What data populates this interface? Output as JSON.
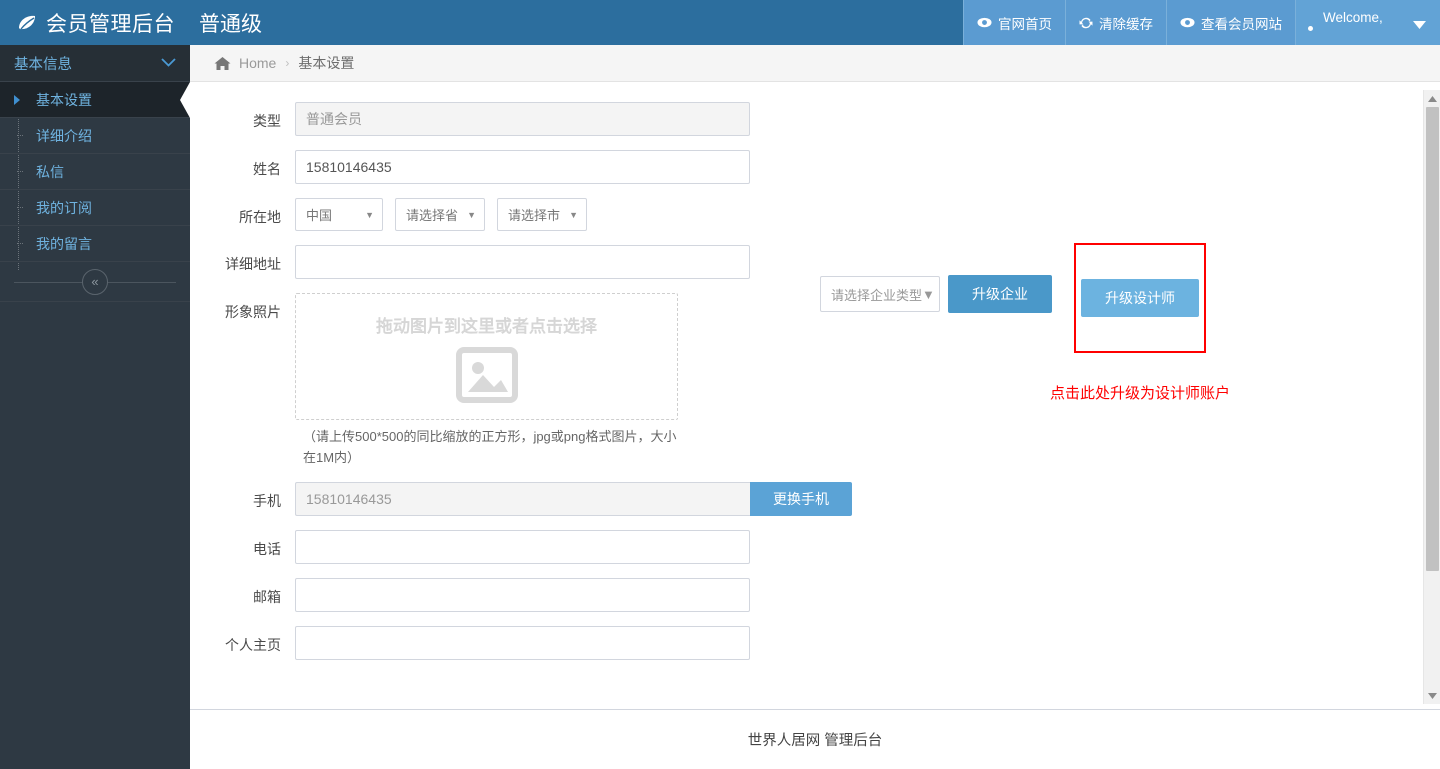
{
  "navbar": {
    "brand_title": "会员管理后台",
    "brand_level": "普通级",
    "logo_icon": "leaf-icon",
    "items": [
      {
        "label": "官网首页",
        "icon": "eye-icon"
      },
      {
        "label": "清除缓存",
        "icon": "refresh-icon"
      },
      {
        "label": "查看会员网站",
        "icon": "eye-icon"
      }
    ],
    "user": {
      "label": "Welcome,",
      "caret_icon": "caret-down-icon"
    },
    "colors": {
      "brand_bg": "#2c6e9e",
      "nav_bg": "#5b9bd1",
      "user_bg": "#62a3d6"
    }
  },
  "sidebar": {
    "header": {
      "label": "基本信息",
      "icon": "chevron-down-icon"
    },
    "items": [
      {
        "label": "基本设置",
        "active": true
      },
      {
        "label": "详细介绍",
        "active": false
      },
      {
        "label": "私信",
        "active": false
      },
      {
        "label": "我的订阅",
        "active": false
      },
      {
        "label": "我的留言",
        "active": false
      }
    ],
    "collapse_icon": "double-chevron-left-icon",
    "colors": {
      "bg": "#2e3943",
      "text": "#6fb3e0",
      "active_bg": "#1d242a"
    }
  },
  "breadcrumb": {
    "home_icon": "home-icon",
    "home_label": "Home",
    "separator": "›",
    "current": "基本设置"
  },
  "form": {
    "fields": [
      {
        "label": "类型",
        "value": "普通会员",
        "placeholder": "",
        "readonly": true
      },
      {
        "label": "姓名",
        "value": "15810146435",
        "placeholder": "",
        "readonly": false
      },
      {
        "label": "详细地址",
        "value": "",
        "placeholder": "",
        "readonly": false
      },
      {
        "label": "电话",
        "value": "",
        "placeholder": "",
        "readonly": false
      },
      {
        "label": "邮箱",
        "value": "",
        "placeholder": "",
        "readonly": false
      },
      {
        "label": "个人主页",
        "value": "",
        "placeholder": "",
        "readonly": false
      }
    ],
    "location": {
      "label": "所在地",
      "country": "中国",
      "province": "请选择省",
      "city": "请选择市",
      "caret_icon": "caret-down-icon"
    },
    "photo": {
      "label": "形象照片",
      "dropzone_text": "拖动图片到这里或者点击选择",
      "image_icon": "image-placeholder-icon",
      "hint": "（请上传500*500的同比缩放的正方形，jpg或png格式图片，大小在1M内）"
    },
    "phone": {
      "label": "手机",
      "value": "15810146435",
      "button_label": "更换手机",
      "button_color": "#5ba3d6"
    }
  },
  "upgrade": {
    "business_type_select": "请选择企业类型",
    "caret_icon": "caret-down-icon",
    "business_button": "升级企业",
    "business_button_color": "#4a98c9",
    "designer_button": "升级设计师",
    "designer_button_color": "#6cb3e0",
    "highlight_color": "#ff0000",
    "annotation": "点击此处升级为设计师账户"
  },
  "footer": {
    "text": "世界人居网 管理后台"
  },
  "scrollbar": {
    "up_icon": "triangle-up-icon",
    "down_icon": "triangle-down-icon"
  }
}
